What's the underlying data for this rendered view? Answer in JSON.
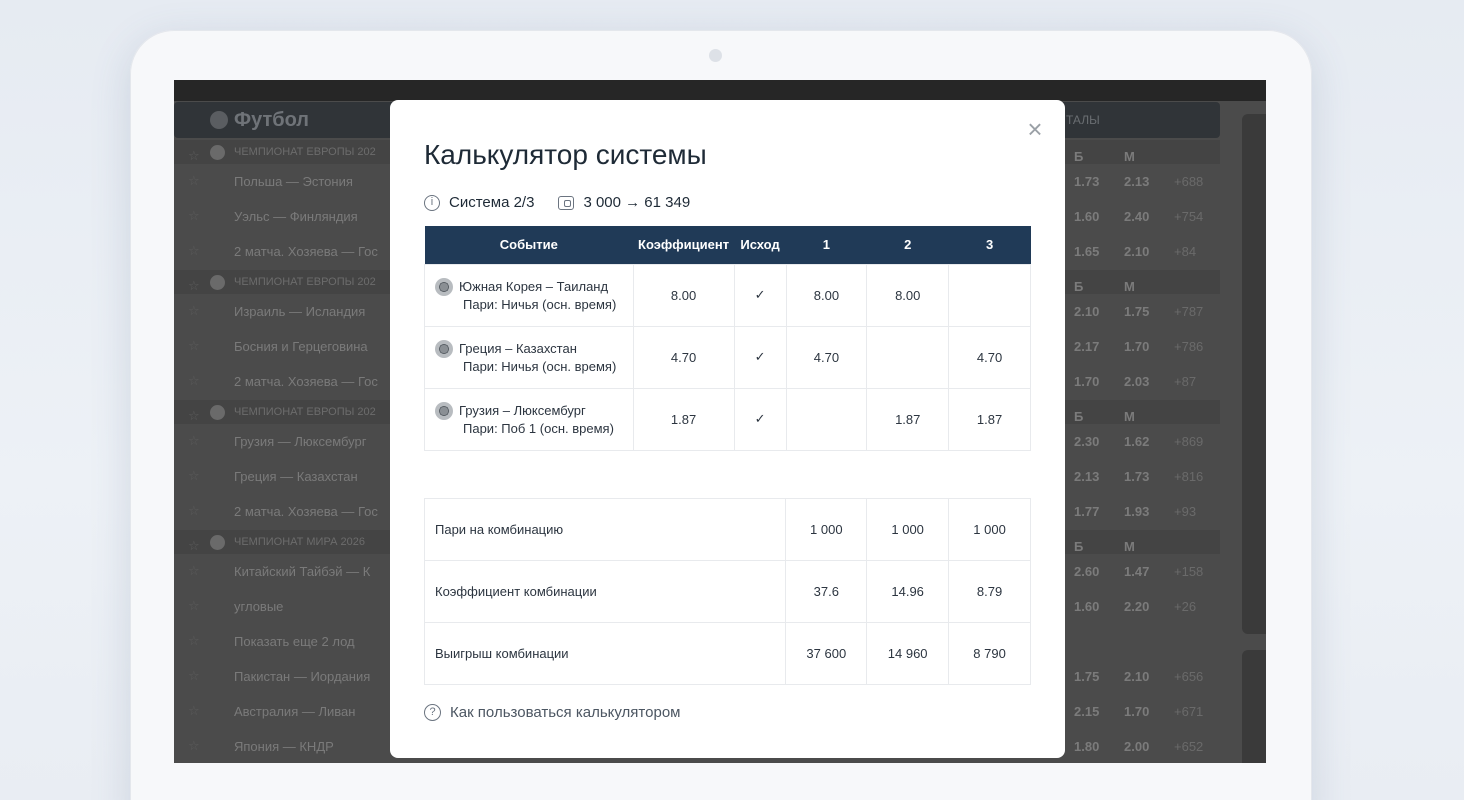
{
  "background": {
    "sport_title": "Футбол",
    "right_header": "ТАЛЫ",
    "rows": [
      {
        "type": "league",
        "name": "ЧЕМПИОНАТ ЕВРОПЫ 202",
        "o1": "Б",
        "o2": "М",
        "o3": ""
      },
      {
        "type": "match",
        "name": "Польша — Эстония",
        "o1": "1.73",
        "o2": "2.13",
        "o3": "+688"
      },
      {
        "type": "match",
        "name": "Уэльс — Финляндия",
        "o1": "1.60",
        "o2": "2.40",
        "o3": "+754"
      },
      {
        "type": "match",
        "name": "2 матча. Хозяева — Гос",
        "o1": "1.65",
        "o2": "2.10",
        "o3": "+84"
      },
      {
        "type": "league",
        "name": "ЧЕМПИОНАТ ЕВРОПЫ 202",
        "o1": "Б",
        "o2": "М",
        "o3": ""
      },
      {
        "type": "match",
        "name": "Израиль — Исландия",
        "o1": "2.10",
        "o2": "1.75",
        "o3": "+787"
      },
      {
        "type": "match",
        "name": "Босния и Герцеговина",
        "o1": "2.17",
        "o2": "1.70",
        "o3": "+786"
      },
      {
        "type": "match",
        "name": "2 матча. Хозяева — Гос",
        "o1": "1.70",
        "o2": "2.03",
        "o3": "+87"
      },
      {
        "type": "league",
        "name": "ЧЕМПИОНАТ ЕВРОПЫ 202",
        "o1": "Б",
        "o2": "М",
        "o3": ""
      },
      {
        "type": "match",
        "name": "Грузия — Люксембург",
        "o1": "2.30",
        "o2": "1.62",
        "o3": "+869"
      },
      {
        "type": "match",
        "name": "Греция — Казахстан",
        "o1": "2.13",
        "o2": "1.73",
        "o3": "+816"
      },
      {
        "type": "match",
        "name": "2 матча. Хозяева — Гос",
        "o1": "1.77",
        "o2": "1.93",
        "o3": "+93"
      },
      {
        "type": "league",
        "name": "ЧЕМПИОНАТ МИРА 2026",
        "o1": "Б",
        "o2": "М",
        "o3": ""
      },
      {
        "type": "match",
        "name": "Китайский Тайбэй — К",
        "o1": "2.60",
        "o2": "1.47",
        "o3": "+158"
      },
      {
        "type": "match",
        "name": "угловые",
        "o1": "1.60",
        "o2": "2.20",
        "o3": "+26"
      },
      {
        "type": "match",
        "name": "Показать еще 2 лод",
        "o1": "",
        "o2": "",
        "o3": ""
      },
      {
        "type": "match",
        "name": "Пакистан — Иордания",
        "o1": "1.75",
        "o2": "2.10",
        "o3": "+656"
      },
      {
        "type": "match",
        "name": "Австралия — Ливан",
        "o1": "2.15",
        "o2": "1.70",
        "o3": "+671"
      },
      {
        "type": "match",
        "name": "Япония — КНДР",
        "o1": "1.80",
        "o2": "2.00",
        "o3": "+652"
      }
    ]
  },
  "modal": {
    "title": "Калькулятор системы",
    "close_label": "×",
    "system_label": "Система 2/3",
    "stake_flow": "3 000 → 61 349",
    "columns": [
      "Событие",
      "Коэффициент",
      "Исход",
      "1",
      "2",
      "3"
    ],
    "bets": [
      {
        "match": "Южная Корея – Таиланд",
        "bet": "Пари: Ничья (осн. время)",
        "coef": "8.00",
        "outcome": "✓",
        "c1": "8.00",
        "c2": "8.00",
        "c3": ""
      },
      {
        "match": "Греция – Казахстан",
        "bet": "Пари: Ничья (осн. время)",
        "coef": "4.70",
        "outcome": "✓",
        "c1": "4.70",
        "c2": "",
        "c3": "4.70"
      },
      {
        "match": "Грузия – Люксембург",
        "bet": "Пари: Поб 1 (осн. время)",
        "coef": "1.87",
        "outcome": "✓",
        "c1": "",
        "c2": "1.87",
        "c3": "1.87"
      }
    ],
    "combos": [
      {
        "label": "Пари на комбинацию",
        "c1": "1 000",
        "c2": "1 000",
        "c3": "1 000"
      },
      {
        "label": "Коэффициент комбинации",
        "c1": "37.6",
        "c2": "14.96",
        "c3": "8.79"
      },
      {
        "label": "Выигрыш комбинации",
        "c1": "37 600",
        "c2": "14 960",
        "c3": "8 790"
      }
    ],
    "help_link": "Как пользоваться калькулятором"
  }
}
